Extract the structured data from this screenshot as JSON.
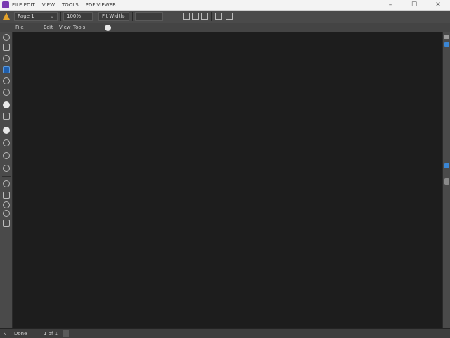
{
  "titlebar": {
    "menus": [
      "FILE EDIT",
      "VIEW",
      "TOOLS",
      "PDF VIEWER"
    ],
    "controls": {
      "minimize": "–",
      "maximize": "☐",
      "close": "✕"
    }
  },
  "toolbar1": {
    "page_field": "Page 1",
    "page_field_chev": "⌄",
    "zoom_field": "100%",
    "view_field": "Fit Width",
    "view_field_chev": "⌄"
  },
  "toolbar2": {
    "items": [
      "File",
      "Edit",
      "View",
      "Tools"
    ],
    "badge": "i"
  },
  "statusbar": {
    "left": "Done",
    "page": "1 of 1"
  },
  "colors": {
    "canvas": "#1d1d1d",
    "panel": "#4a4a4a",
    "accent": "#3b86d4",
    "warning": "#e3a22a",
    "app_icon": "#7a3bb1"
  }
}
